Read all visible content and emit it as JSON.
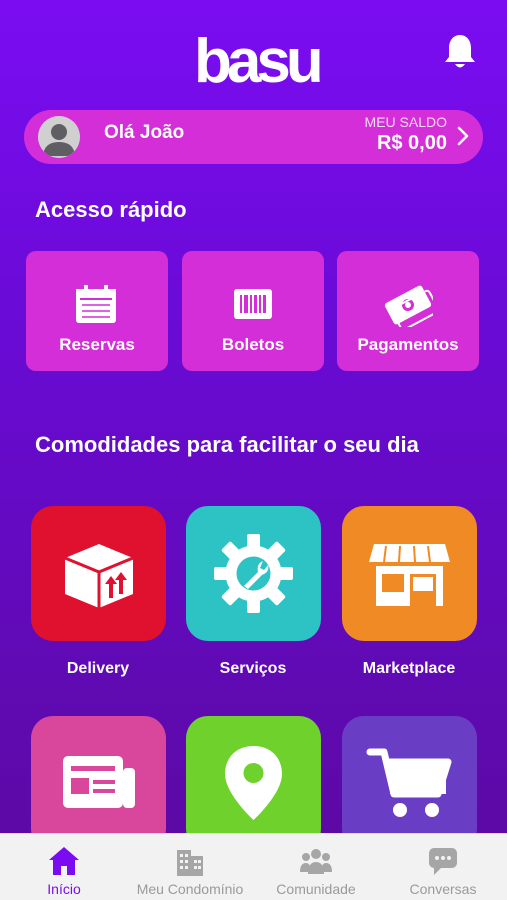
{
  "header": {
    "logo": "basu",
    "bell_icon": "bell-icon"
  },
  "balance": {
    "greeting": "Olá João",
    "label": "MEU SALDO",
    "value": "R$ 0,00"
  },
  "quick_access": {
    "title": "Acesso rápido",
    "items": [
      {
        "label": "Reservas",
        "icon": "calendar-icon"
      },
      {
        "label": "Boletos",
        "icon": "barcode-icon"
      },
      {
        "label": "Pagamentos",
        "icon": "money-icon"
      }
    ]
  },
  "amenities": {
    "title": "Comodidades para facilitar o seu dia",
    "items": [
      {
        "label": "Delivery",
        "icon": "package-icon",
        "color": "#e0102f"
      },
      {
        "label": "Serviços",
        "icon": "gear-wrench-icon",
        "color": "#2dc2c4"
      },
      {
        "label": "Marketplace",
        "icon": "storefront-icon",
        "color": "#f08a24"
      },
      {
        "label": "",
        "icon": "newspaper-icon",
        "color": "#d9479c"
      },
      {
        "label": "",
        "icon": "map-pin-icon",
        "color": "#6fd12b"
      },
      {
        "label": "",
        "icon": "cart-icon",
        "color": "#6a3ec4"
      }
    ]
  },
  "tabbar": {
    "items": [
      {
        "label": "Início",
        "icon": "home-icon",
        "active": true
      },
      {
        "label": "Meu Condomínio",
        "icon": "building-icon",
        "active": false
      },
      {
        "label": "Comunidade",
        "icon": "people-icon",
        "active": false
      },
      {
        "label": "Conversas",
        "icon": "chat-icon",
        "active": false
      }
    ]
  },
  "colors": {
    "primary": "#7b0cf2",
    "accent": "#d42ed9"
  }
}
